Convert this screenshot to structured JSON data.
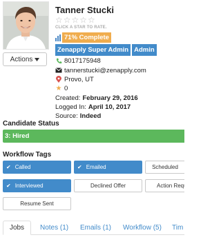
{
  "profile": {
    "name": "Tanner Stucki",
    "stars": "☆☆☆☆☆",
    "rate_hint": "CLICK A STAR TO RATE.",
    "complete_label": "71% Complete",
    "complete_percent": 71,
    "roles": [
      "Zenapply Super Admin",
      "Admin"
    ],
    "phone": "8017175948",
    "email": "tannerstucki@zenapply.com",
    "location": "Provo, UT",
    "score": "0",
    "created_label": "Created:",
    "created_value": "February 29, 2016",
    "logged_in_label": "Logged In:",
    "logged_in_value": "April 10, 2017",
    "source_label": "Source:",
    "source_value": "Indeed"
  },
  "actions": {
    "label": "Actions",
    "icon": "caret-down-icon"
  },
  "candidate_status": {
    "heading": "Candidate Status",
    "value": "3: Hired",
    "color": "#5cb85c"
  },
  "workflow_tags": {
    "heading": "Workflow Tags",
    "items": [
      {
        "label": "Called",
        "active": true
      },
      {
        "label": "Emailed",
        "active": true
      },
      {
        "label": "Scheduled",
        "active": false
      },
      {
        "label": "Interviewed",
        "active": true
      },
      {
        "label": "Declined Offer",
        "active": false
      },
      {
        "label": "Action Requ",
        "active": false
      },
      {
        "label": "Resume Sent",
        "active": false
      }
    ]
  },
  "tabs": [
    {
      "label": "Jobs",
      "active": true
    },
    {
      "label": "Notes (1)",
      "active": false
    },
    {
      "label": "Emails (1)",
      "active": false
    },
    {
      "label": "Workflow (5)",
      "active": false
    },
    {
      "label": "Tim",
      "active": false
    }
  ],
  "colors": {
    "primary": "#428bca",
    "warning": "#f0ad4e",
    "success": "#5cb85c"
  }
}
